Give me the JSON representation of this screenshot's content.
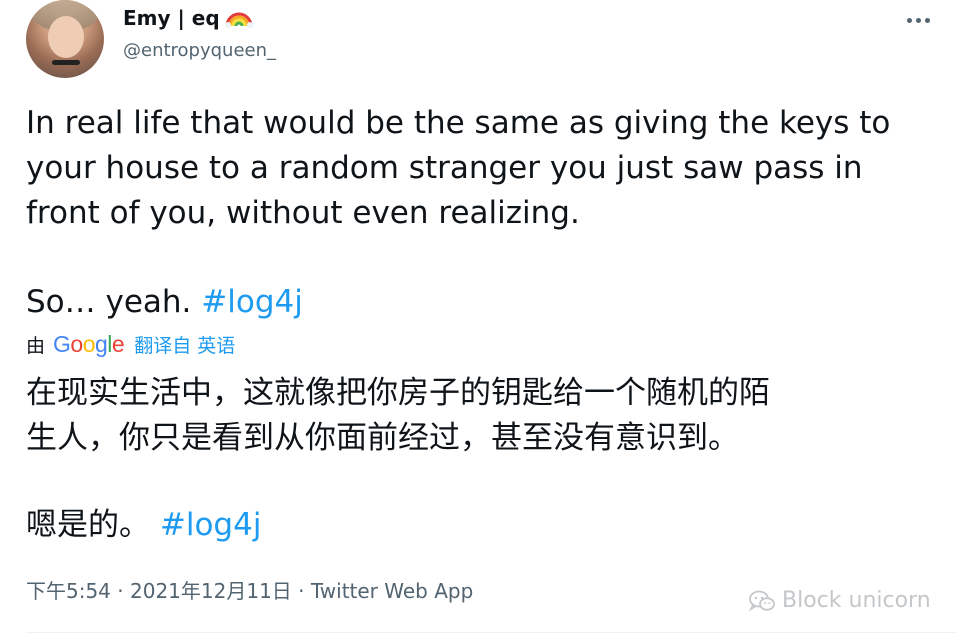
{
  "author": {
    "name": "Emy | eq",
    "handle": "@entropyqueen_"
  },
  "tweet": {
    "lines": [
      "In real life that would be the same as giving the keys to",
      "your house to a random stranger you just saw pass in",
      "front of you, without even realizing."
    ],
    "second_paragraph_text": "So… yeah. ",
    "hashtag": "#log4j"
  },
  "translation": {
    "by_label": "由",
    "provider_letters": [
      "G",
      "o",
      "o",
      "g",
      "l",
      "e"
    ],
    "translated_from": "翻译自 英语",
    "lines": [
      "在现实生活中，这就像把你房子的钥匙给一个随机的陌",
      "生人，你只是看到从你面前经过，甚至没有意识到。"
    ],
    "second_paragraph_text": "嗯是的。 ",
    "hashtag": "#log4j"
  },
  "meta": {
    "time": "下午5:54",
    "separator": " · ",
    "date": "2021年12月11日",
    "source": "Twitter Web App"
  },
  "watermark": {
    "text": "Block unicorn"
  },
  "icons": {
    "more": "more-horizontal-icon",
    "rainbow": "rainbow-emoji-icon",
    "wechat": "wechat-icon"
  },
  "colors": {
    "text": "#0f1419",
    "secondary": "#536471",
    "accent": "#1d9bf0"
  }
}
